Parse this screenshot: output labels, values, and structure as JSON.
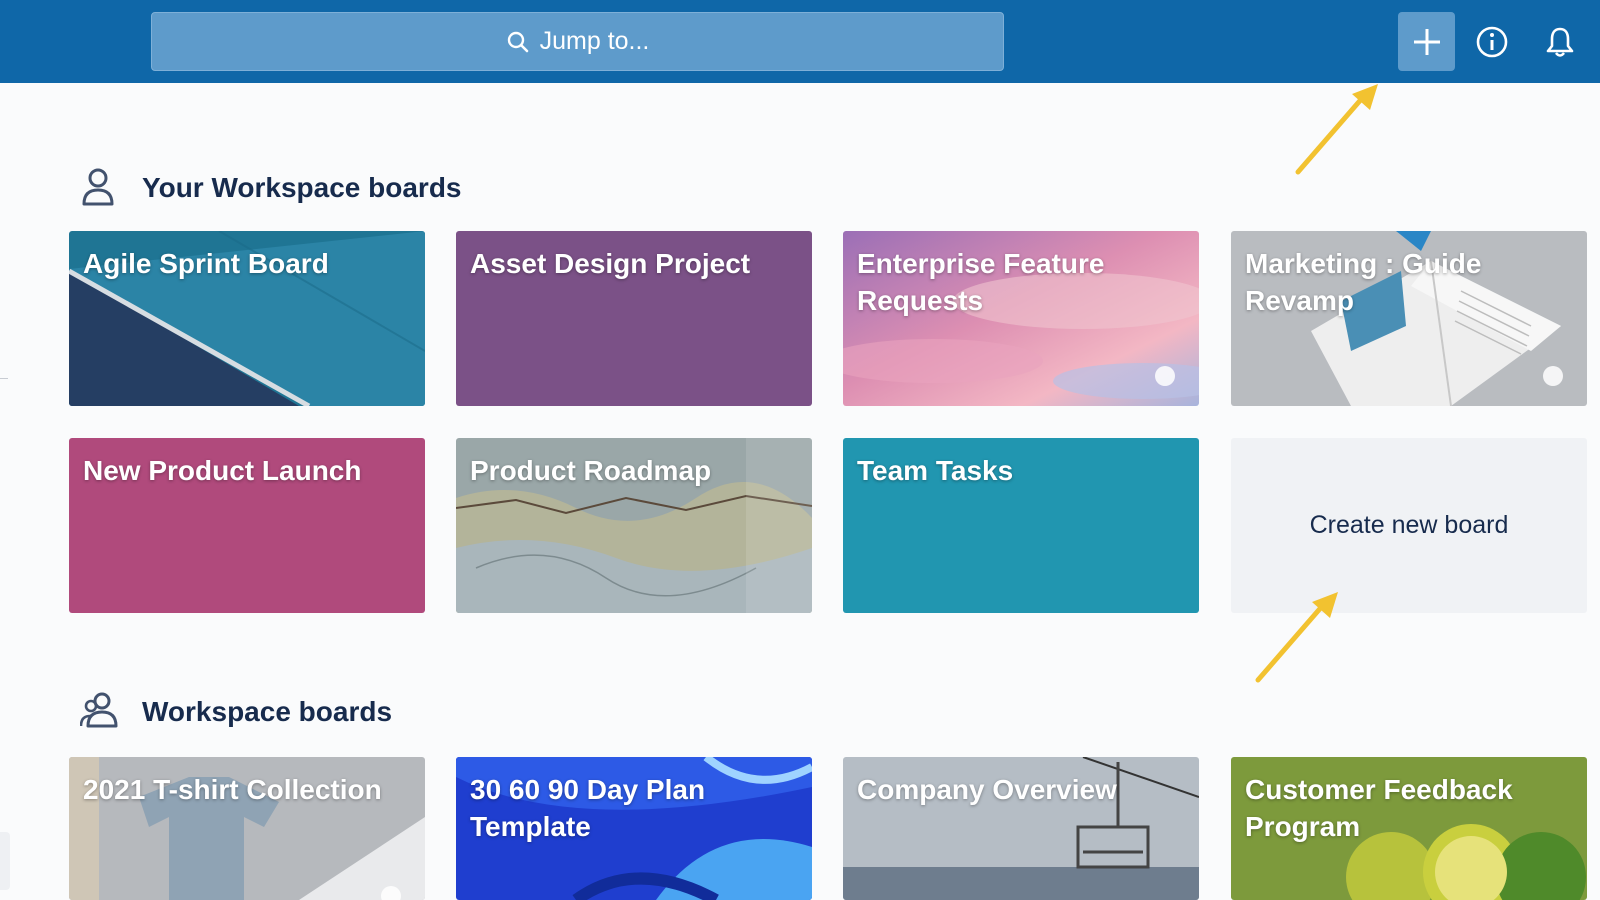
{
  "header": {
    "search_placeholder": "Jump to...",
    "icons": [
      "search-icon",
      "plus-icon",
      "info-icon",
      "bell-icon"
    ],
    "background_color": "#0f67a8"
  },
  "sections": {
    "your_boards": {
      "title": "Your Workspace boards",
      "icon": "person-icon",
      "boards": [
        {
          "title": "Agile Sprint Board",
          "background": "image"
        },
        {
          "title": "Asset Design Project",
          "background": "#7b5187"
        },
        {
          "title": "Enterprise Feature Requests",
          "background": "image"
        },
        {
          "title": "Marketing : Guide Revamp",
          "background": "image"
        },
        {
          "title": "New Product Launch",
          "background": "#b04a7c"
        },
        {
          "title": "Product Roadmap",
          "background": "image"
        },
        {
          "title": "Team Tasks",
          "background": "#2196b0"
        }
      ],
      "create_label": "Create new board"
    },
    "workspace_boards": {
      "title": "Workspace boards",
      "icon": "people-icon",
      "boards": [
        {
          "title": "2021 T-shirt Collection",
          "background": "image"
        },
        {
          "title": "30 60 90 Day Plan Template",
          "background": "image"
        },
        {
          "title": "Company Overview",
          "background": "image"
        },
        {
          "title": "Customer Feedback Program",
          "background": "image"
        }
      ]
    }
  },
  "annotations": {
    "arrow_color": "#f2c230"
  }
}
